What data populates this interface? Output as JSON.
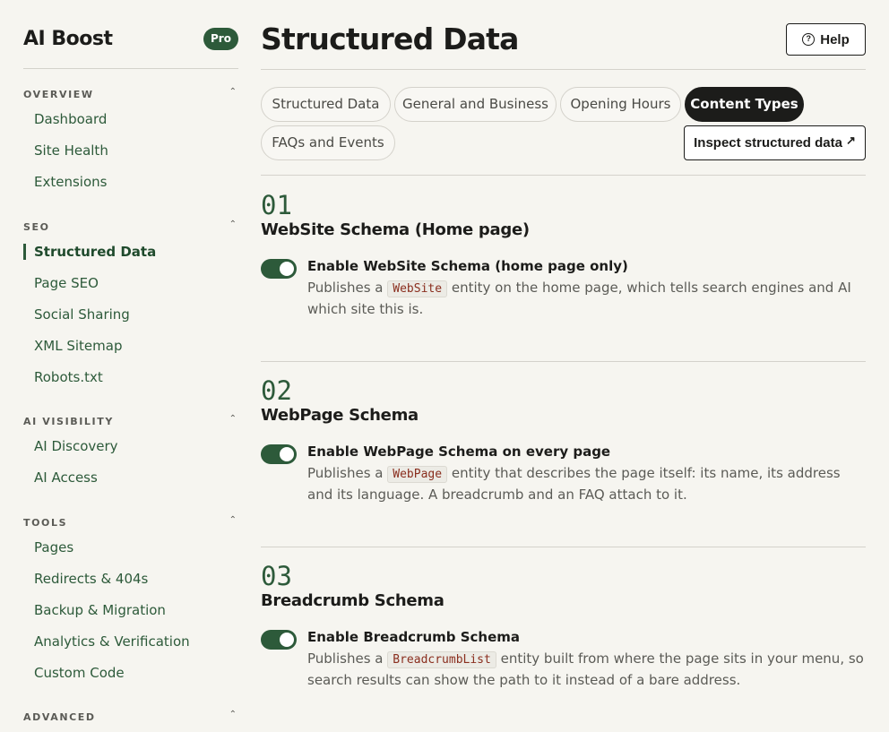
{
  "brand": {
    "title": "AI Boost",
    "badge": "Pro"
  },
  "sidebar": {
    "sections": [
      {
        "label": "OVERVIEW",
        "items": [
          "Dashboard",
          "Site Health",
          "Extensions"
        ]
      },
      {
        "label": "SEO",
        "items": [
          "Structured Data",
          "Page SEO",
          "Social Sharing",
          "XML Sitemap",
          "Robots.txt"
        ],
        "active": "Structured Data"
      },
      {
        "label": "AI VISIBILITY",
        "items": [
          "AI Discovery",
          "AI Access"
        ]
      },
      {
        "label": "TOOLS",
        "items": [
          "Pages",
          "Redirects & 404s",
          "Backup & Migration",
          "Analytics & Verification",
          "Custom Code"
        ]
      },
      {
        "label": "ADVANCED",
        "items": []
      }
    ]
  },
  "header": {
    "title": "Structured Data",
    "help_label": "Help"
  },
  "tabs": {
    "items": [
      "Structured Data",
      "General and Business",
      "Opening Hours",
      "Content Types",
      "FAQs and Events"
    ],
    "active": "Content Types",
    "inspect_label": "Inspect structured data"
  },
  "schemas": [
    {
      "number": "01",
      "title": "WebSite Schema (Home page)",
      "option_title": "Enable WebSite Schema (home page only)",
      "enabled": true,
      "desc_before": "Publishes a",
      "code": "WebSite",
      "desc_after": "entity on the home page, which tells search engines and AI which site this is."
    },
    {
      "number": "02",
      "title": "WebPage Schema",
      "option_title": "Enable WebPage Schema on every page",
      "enabled": true,
      "desc_before": "Publishes a",
      "code": "WebPage",
      "desc_after": "entity that describes the page itself: its name, its address and its language. A breadcrumb and an FAQ attach to it."
    },
    {
      "number": "03",
      "title": "Breadcrumb Schema",
      "option_title": "Enable Breadcrumb Schema",
      "enabled": true,
      "desc_before": "Publishes a",
      "code": "BreadcrumbList",
      "desc_after": "entity built from where the page sits in your menu, so search results can show the path to it instead of a bare address."
    }
  ],
  "icons": {
    "help": "question-circle-icon",
    "inspect": "external-link-icon",
    "section_toggle": "chevron-up-icon"
  },
  "colors": {
    "accent": "#2d5a3a",
    "background": "#f6f5f0",
    "active_tab": "#1c1c1a",
    "code_text": "#8a2e1e"
  }
}
